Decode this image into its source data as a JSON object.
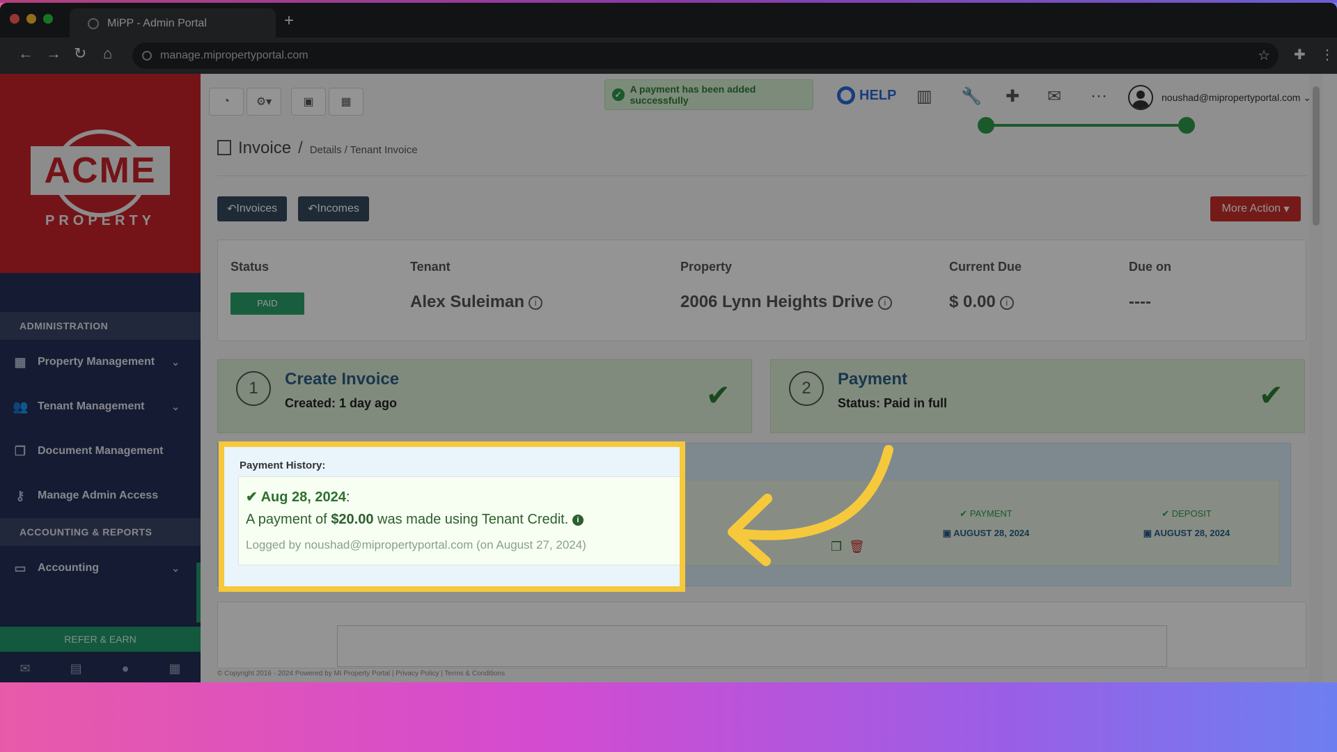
{
  "browser": {
    "tab_title": "MiPP - Admin Portal",
    "url": "manage.mipropertyportal.com"
  },
  "sidebar": {
    "logo_text": "ACME",
    "logo_sub": "PROPERTY",
    "section_admin": "ADMINISTRATION",
    "items_admin": [
      {
        "label": "Property Management",
        "icon": "building-icon"
      },
      {
        "label": "Tenant Management",
        "icon": "users-icon"
      },
      {
        "label": "Document Management",
        "icon": "documents-icon"
      },
      {
        "label": "Manage Admin Access",
        "icon": "key-icon"
      }
    ],
    "section_accounting": "ACCOUNTING & REPORTS",
    "accounting_label": "Accounting",
    "refer_label": "REFER & EARN"
  },
  "topbar": {
    "toast": "A payment has been added successfully",
    "help_label": "HELP",
    "user_email": "noushad@mipropertyportal.com"
  },
  "breadcrumb": {
    "page": "Invoice",
    "sep": "/",
    "rest": "Details / Tenant Invoice"
  },
  "actions": {
    "invoices_label": "Invoices",
    "incomes_label": "Incomes",
    "more_action_label": "More Action"
  },
  "info": {
    "status_label": "Status",
    "status_value": "PAID",
    "tenant_label": "Tenant",
    "tenant_value": "Alex Suleiman",
    "property_label": "Property",
    "property_value": "2006 Lynn Heights Drive",
    "due_label": "Current Due",
    "due_value": "$ 0.00",
    "dueon_label": "Due on",
    "dueon_value": "----"
  },
  "steps": [
    {
      "num": "1",
      "title": "Create Invoice",
      "sub": "Created: 1 day ago"
    },
    {
      "num": "2",
      "title": "Payment",
      "sub": "Status: Paid in full"
    }
  ],
  "history": {
    "title": "Payment History:",
    "date": "Aug 28, 2024",
    "line_prefix": "A payment of",
    "amount": "$20.00",
    "line_suffix": "was made using Tenant Credit.",
    "log": "Logged by noushad@mipropertyportal.com (on August 27, 2024)"
  },
  "timeline": [
    {
      "label": "PAYMENT",
      "date": "AUGUST 28, 2024"
    },
    {
      "label": "DEPOSIT",
      "date": "AUGUST 28, 2024"
    }
  ],
  "footer": {
    "copyright": "© Copyright 2016 - 2024 Powered by MI Property Portal | Privacy Policy | Terms & Conditions"
  },
  "colors": {
    "highlight": "#f6c93c",
    "brand_red": "#c9232a",
    "sidebar": "#233057",
    "success": "#2e9a4a"
  }
}
